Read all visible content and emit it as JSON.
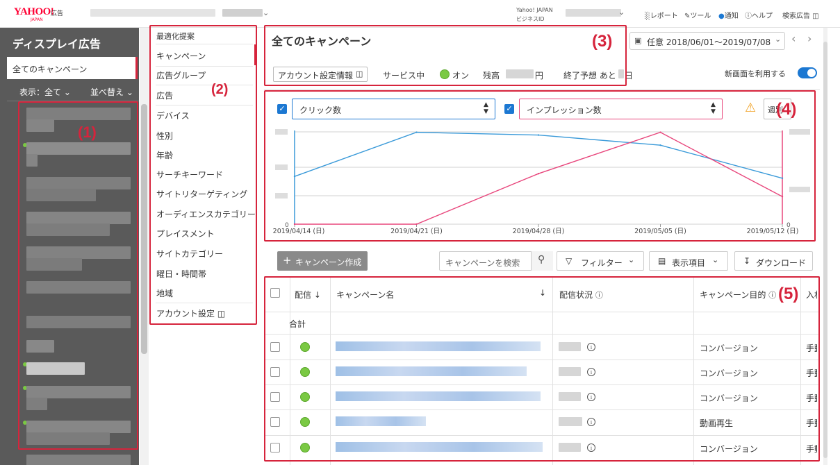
{
  "top": {
    "logo": "YAHOO!",
    "logo_japan": "JAPAN",
    "logo_sub": "広告",
    "account_line1": "Yahoo! JAPAN",
    "account_line2": "ビジネスID",
    "links": [
      "レポート",
      "ツール",
      "通知",
      "ヘルプ",
      "検索広告"
    ]
  },
  "sidebar": {
    "title": "ディスプレイ広告",
    "all_campaigns": "全てのキャンペーン",
    "display": "表示：全て",
    "sort": "並べ替え"
  },
  "nav": {
    "items": [
      "最適化提案",
      "キャンペーン",
      "広告グループ",
      "広告",
      "デバイス",
      "性別",
      "年齢",
      "サーチキーワード",
      "サイトリターゲティング",
      "オーディエンスカテゴリー",
      "プレイスメント",
      "サイトカテゴリー",
      "曜日・時間帯",
      "地域",
      "アカウント設定"
    ]
  },
  "header": {
    "title": "全てのキャンペーン",
    "date_range": "任意 2018/06/01～2019/07/08",
    "account_settings": "アカウント設定情報",
    "service": "サービス中",
    "on": "オン",
    "balance_label": "残高",
    "balance_unit": "円",
    "forecast_label": "終了予想 あと",
    "forecast_unit": "日",
    "new_screen": "新画面を利用する"
  },
  "chart": {
    "metric1": "クリック数",
    "metric2": "インプレッション数",
    "period_btn": "週別",
    "zero_left": "0",
    "zero_right": "0"
  },
  "chart_data": {
    "type": "line",
    "x": [
      "2019/04/14 (日)",
      "2019/04/21 (日)",
      "2019/04/28 (日)",
      "2019/05/05 (日)",
      "2019/05/12 (日)"
    ],
    "series": [
      {
        "name": "クリック数",
        "values": [
          0.52,
          1.0,
          0.97,
          0.86,
          0.5
        ]
      },
      {
        "name": "インプレッション数",
        "values": [
          0,
          0,
          0.55,
          1.0,
          0.3
        ]
      }
    ],
    "ylim": [
      0,
      1.05
    ],
    "colors": [
      "#3a9ad9",
      "#e8467c"
    ]
  },
  "table": {
    "create_btn": "キャンペーン作成",
    "search_placeholder": "キャンペーンを検索",
    "filter": "フィルター",
    "columns_btn": "表示項目",
    "download": "ダウンロード",
    "headers": [
      "配信",
      "キャンペーン名",
      "配信状況",
      "キャンペーン目的",
      "入札"
    ],
    "total": "合計",
    "rows": [
      {
        "goal": "コンバージョン",
        "bid": "手動"
      },
      {
        "goal": "コンバージョン",
        "bid": "手動"
      },
      {
        "goal": "コンバージョン",
        "bid": "手動"
      },
      {
        "goal": "動画再生",
        "bid": "手動"
      },
      {
        "goal": "コンバージョン",
        "bid": "手動"
      }
    ]
  },
  "annotations": [
    "(1)",
    "(2)",
    "(3)",
    "(4)",
    "(5)"
  ]
}
